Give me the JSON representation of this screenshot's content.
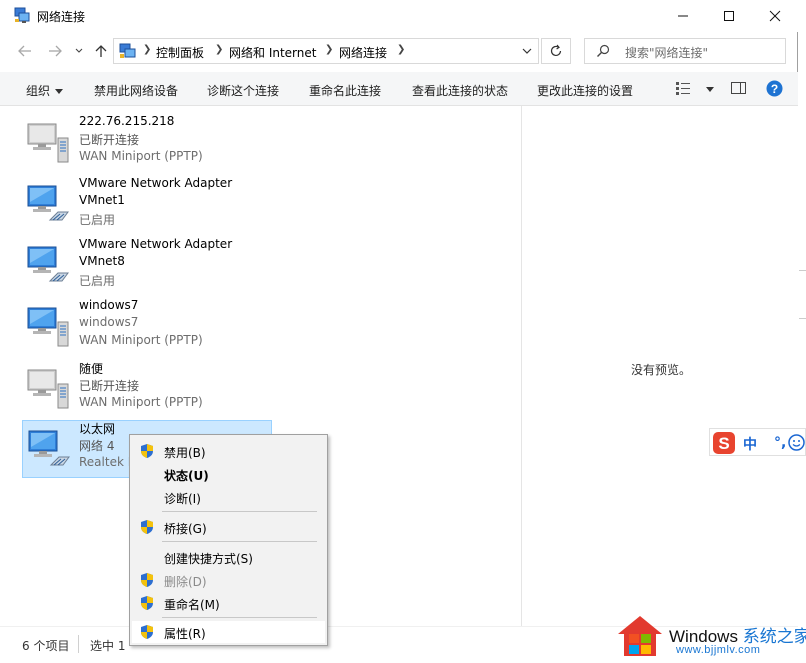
{
  "window": {
    "title": "网络连接",
    "controls": {
      "minimize_icon": "minimize-icon",
      "maximize_icon": "maximize-icon",
      "close_icon": "close-icon"
    }
  },
  "address_bar": {
    "crumbs": [
      "控制面板",
      "网络和 Internet",
      "网络连接"
    ],
    "search_placeholder": "搜索\"网络连接\""
  },
  "commands": {
    "organize": "组织",
    "disable": "禁用此网络设备",
    "diagnose": "诊断这个连接",
    "rename": "重命名此连接",
    "status": "查看此连接的状态",
    "settings": "更改此连接的设置"
  },
  "connections": [
    {
      "line1": "222.76.215.218",
      "line2": "已断开连接",
      "line3": "WAN Miniport (PPTP)",
      "icon": "wan-connection-icon"
    },
    {
      "line1": "VMware Network Adapter",
      "line2": "VMnet1",
      "line3": "已启用",
      "icon": "ethernet-connection-icon"
    },
    {
      "line1": "VMware Network Adapter",
      "line2": "VMnet8",
      "line3": "已启用",
      "icon": "ethernet-connection-icon"
    },
    {
      "line1": "windows7",
      "line2": "windows7",
      "line3": "WAN Miniport (PPTP)",
      "icon": "wan-connection-icon"
    },
    {
      "line1": "随便",
      "line2": "已断开连接",
      "line3": "WAN Miniport (PPTP)",
      "icon": "wan-connection-icon"
    },
    {
      "line1": "以太网",
      "line2": "网络 4",
      "line3": "Realtek I",
      "icon": "ethernet-connection-icon",
      "selected": true
    }
  ],
  "preview": {
    "empty_text": "没有预览。"
  },
  "context_menu": {
    "items": [
      {
        "label": "禁用(B)",
        "shield": true
      },
      {
        "label": "状态(U)",
        "bold": true
      },
      {
        "label": "诊断(I)"
      },
      {
        "label": "桥接(G)",
        "shield": true
      },
      {
        "label": "创建快捷方式(S)"
      },
      {
        "label": "删除(D)",
        "shield": true,
        "disabled": true
      },
      {
        "label": "重命名(M)",
        "shield": true
      },
      {
        "label": "属性(R)",
        "shield": true,
        "hover": true
      }
    ]
  },
  "status_bar": {
    "count": "6 个项目",
    "selected": "选中 1"
  },
  "ime": {
    "mode": "中",
    "punct": "°,",
    "logo": "sogou-s-icon"
  },
  "watermark": {
    "brand": "Windows",
    "brand_cn": "系统之家",
    "url": "www.bjjmlv.com"
  },
  "colors": {
    "selection_bg": "#cce8ff",
    "selection_border": "#99d1ff",
    "accent_blue": "#1976d2",
    "help_blue": "#1e73d2"
  }
}
